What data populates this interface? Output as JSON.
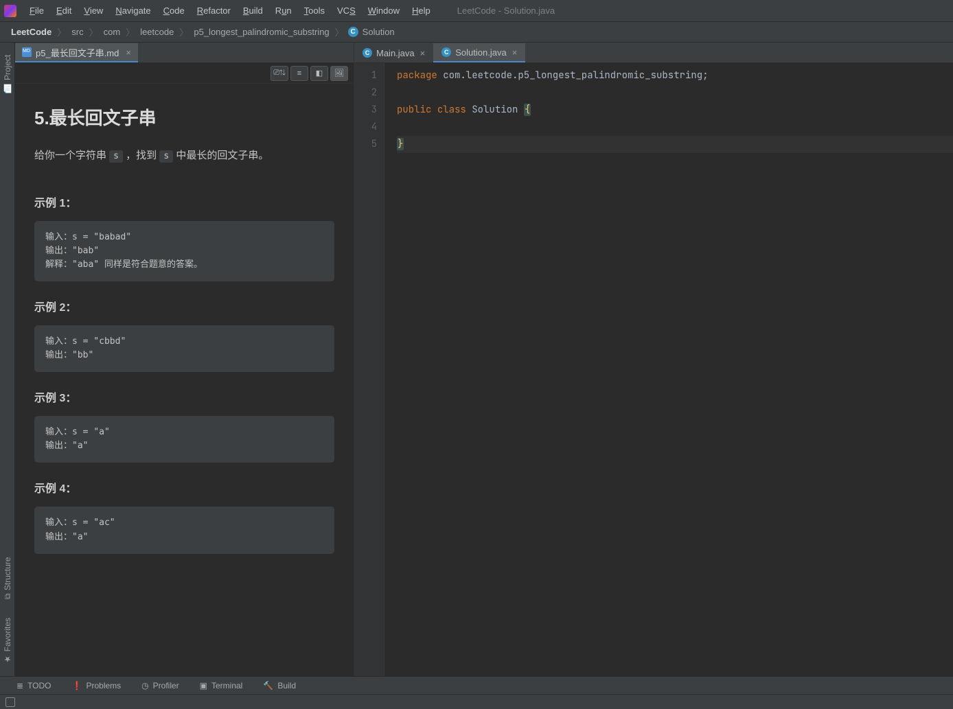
{
  "window": {
    "title": "LeetCode - Solution.java"
  },
  "menu": {
    "items": [
      {
        "u": "F",
        "rest": "ile"
      },
      {
        "u": "E",
        "rest": "dit"
      },
      {
        "u": "V",
        "rest": "iew"
      },
      {
        "u": "N",
        "rest": "avigate"
      },
      {
        "u": "C",
        "rest": "ode"
      },
      {
        "u": "R",
        "rest": "efactor"
      },
      {
        "u": "B",
        "rest": "uild"
      },
      {
        "u": "R",
        "rest": "un",
        "pre": ""
      },
      {
        "u": "T",
        "rest": "ools"
      },
      {
        "u": "V",
        "rest": "CS",
        "pre": ""
      },
      {
        "u": "",
        "rest": "",
        "raw": "VC"
      },
      {
        "u": "W",
        "rest": "indow"
      },
      {
        "u": "H",
        "rest": "elp"
      }
    ],
    "file": "File",
    "edit": "Edit",
    "view": "View",
    "navigate": "Navigate",
    "code": "Code",
    "refactor": "Refactor",
    "build": "Build",
    "run": "Run",
    "tools": "Tools",
    "vcs": "VCS",
    "window": "Window",
    "help": "Help"
  },
  "breadcrumbs": {
    "c0": "LeetCode",
    "c1": "src",
    "c2": "com",
    "c3": "leetcode",
    "c4": "p5_longest_palindromic_substring",
    "c5": "Solution"
  },
  "leftRail": {
    "project": "Project",
    "structure": "Structure",
    "favorites": "Favorites"
  },
  "mdPanel": {
    "tab": "p5_最长回文子串.md",
    "h1": "5.最长回文子串",
    "intro_a": "给你一个字符串 ",
    "intro_code": "s",
    "intro_b": " ，找到 ",
    "intro_code2": "s",
    "intro_c": " 中最长的回文子串。",
    "ex1_title": "示例 1：",
    "ex1_body": "输入：s = \"babad\"\n输出：\"bab\"\n解释：\"aba\" 同样是符合题意的答案。",
    "ex2_title": "示例 2：",
    "ex2_body": "输入：s = \"cbbd\"\n输出：\"bb\"",
    "ex3_title": "示例 3：",
    "ex3_body": "输入：s = \"a\"\n输出：\"a\"",
    "ex4_title": "示例 4：",
    "ex4_body": "输入：s = \"ac\"\n输出：\"a\""
  },
  "codePanel": {
    "tab1": "Main.java",
    "tab2": "Solution.java",
    "gutter": [
      "1",
      "2",
      "3",
      "4",
      "5"
    ],
    "line1": {
      "kw": "package ",
      "rest": "com.leetcode.p5_longest_palindromic_substring",
      "end": ";"
    },
    "line3": {
      "kw1": "public ",
      "kw2": "class ",
      "cls": "Solution ",
      "brace": "{"
    },
    "line5": {
      "brace": "}"
    }
  },
  "bottom": {
    "todo": "TODO",
    "problems": "Problems",
    "profiler": "Profiler",
    "terminal": "Terminal",
    "build": "Build"
  }
}
